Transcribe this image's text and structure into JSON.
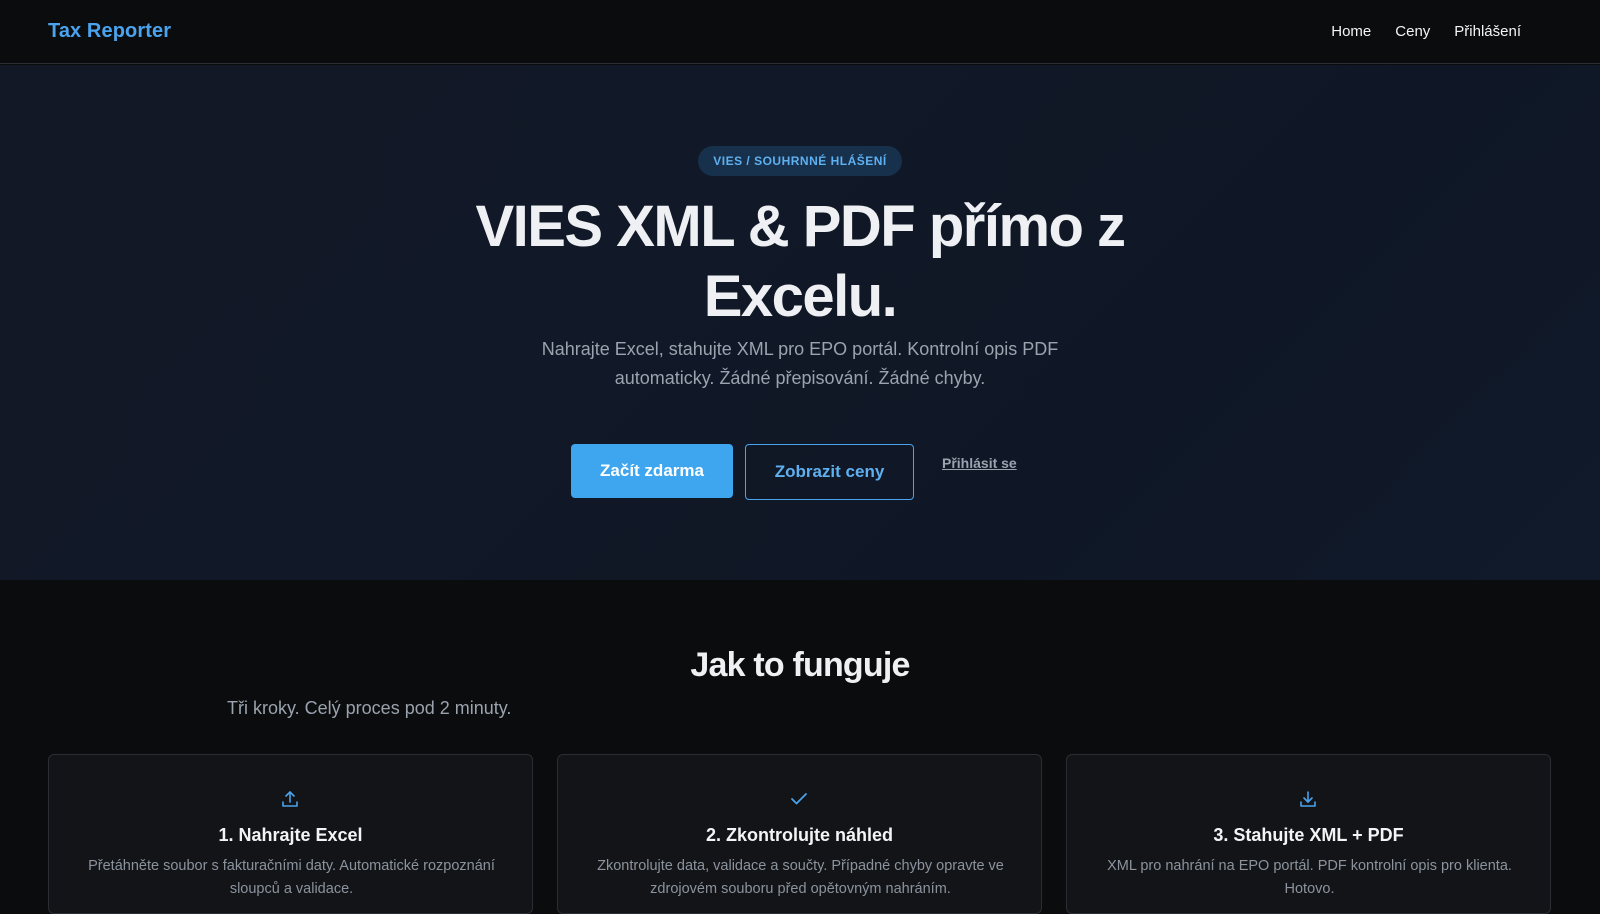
{
  "nav": {
    "brand": "Tax Reporter",
    "links": [
      "Home",
      "Ceny",
      "Přihlášení"
    ]
  },
  "hero": {
    "badge": "VIES / SOUHRNNÉ HLÁŠENÍ",
    "title": "VIES XML & PDF přímo z Excelu.",
    "subtitle": "Nahrajte Excel, stahujte XML pro EPO portál. Kontrolní opis PDF automaticky. Žádné přepisování. Žádné chyby.",
    "cta_primary": "Začít zdarma",
    "cta_secondary": "Zobrazit ceny",
    "login_link": "Přihlásit se"
  },
  "how": {
    "title": "Jak to funguje",
    "subtitle": "Tři kroky. Celý proces pod 2 minuty.",
    "steps": [
      {
        "icon": "upload-icon",
        "title": "1. Nahrajte Excel",
        "text": "Přetáhněte soubor s fakturačními daty. Automatické rozpoznání sloupců a validace."
      },
      {
        "icon": "check-icon",
        "title": "2. Zkontrolujte náhled",
        "text": "Zkontrolujte data, validace a součty. Případné chyby opravte ve zdrojovém souboru před opětovným nahráním."
      },
      {
        "icon": "download-icon",
        "title": "3. Stahujte XML + PDF",
        "text": "XML pro nahrání na EPO portál. PDF kontrolní opis pro klienta. Hotovo."
      }
    ]
  },
  "colors": {
    "accent": "#3ea5ef",
    "brand": "#4aa3ee",
    "background": "#0b0c0e",
    "hero_background": "#111827"
  }
}
